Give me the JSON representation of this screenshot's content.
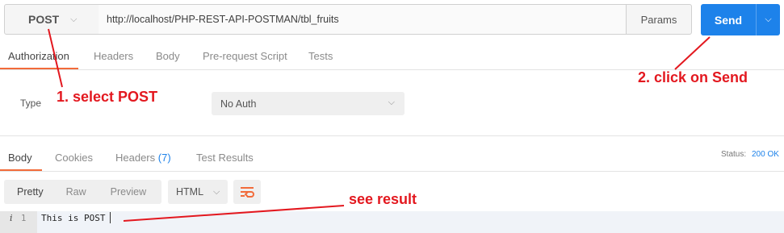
{
  "request": {
    "method": "POST",
    "url": "http://localhost/PHP-REST-API-POSTMAN/tbl_fruits",
    "params_label": "Params",
    "send_label": "Send"
  },
  "request_tabs": [
    "Authorization",
    "Headers",
    "Body",
    "Pre-request Script",
    "Tests"
  ],
  "auth": {
    "type_label": "Type",
    "selected": "No Auth"
  },
  "response_tabs": {
    "body": "Body",
    "cookies": "Cookies",
    "headers": "Headers",
    "headers_count": "(7)",
    "test_results": "Test Results"
  },
  "status": {
    "label": "Status:",
    "value": "200 OK"
  },
  "view": {
    "modes": [
      "Pretty",
      "Raw",
      "Preview"
    ],
    "format": "HTML"
  },
  "editor": {
    "info_marker": "i",
    "line_number": "1",
    "content": "This is POST"
  },
  "annotations": {
    "select_post": "1. select POST",
    "click_send": "2. click on Send",
    "see_result": "see result"
  },
  "colors": {
    "accent": "#f26b3a",
    "send": "#1d82ea",
    "annotation": "#e3181f"
  },
  "icons": [
    "chevron-down-icon",
    "wrap-lines-icon"
  ]
}
